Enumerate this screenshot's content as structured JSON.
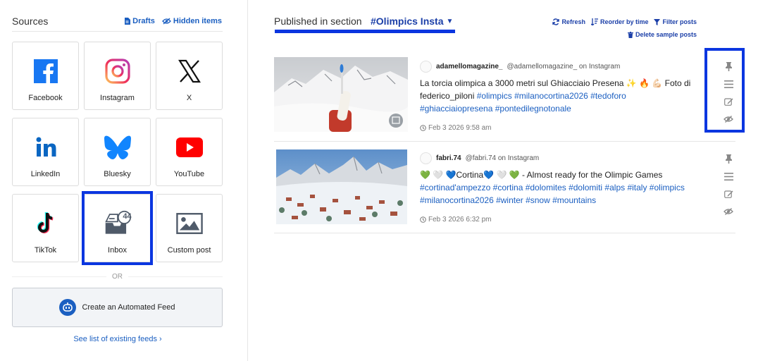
{
  "sources": {
    "title": "Sources",
    "drafts_label": "Drafts",
    "hidden_label": "Hidden items",
    "tiles": [
      {
        "label": "Facebook",
        "icon": "facebook-icon"
      },
      {
        "label": "Instagram",
        "icon": "instagram-icon"
      },
      {
        "label": "X",
        "icon": "x-icon"
      },
      {
        "label": "LinkedIn",
        "icon": "linkedin-icon"
      },
      {
        "label": "Bluesky",
        "icon": "bluesky-icon"
      },
      {
        "label": "YouTube",
        "icon": "youtube-icon"
      },
      {
        "label": "TikTok",
        "icon": "tiktok-icon"
      },
      {
        "label": "Inbox",
        "icon": "inbox-icon",
        "badge": "44"
      },
      {
        "label": "Custom post",
        "icon": "image-icon"
      }
    ],
    "or_label": "OR",
    "automated_feed_label": "Create an Automated Feed",
    "see_list_label": "See list of existing feeds ›"
  },
  "header": {
    "published_label": "Published in section",
    "section_name": "#Olimpics Insta",
    "refresh_label": "Refresh",
    "reorder_label": "Reorder by time",
    "filter_label": "Filter posts",
    "delete_sample_label": "Delete sample posts"
  },
  "colors": {
    "accent": "#1b5fc1",
    "highlight": "#0b36e0",
    "facebook": "#1877f2",
    "youtube": "#ff0000",
    "bluesky": "#1185fe"
  },
  "posts": [
    {
      "username": "adamellomagazine_",
      "handle": "@adamellomagazine_ on Instagram",
      "text": "La torcia olimpica a 3000 metri sul Ghiacciaio Presena ✨ 🔥 💪🏻 Foto di federico_piloni ",
      "tags": "#olimpics #milanocortina2026 #tedoforo #ghiacciaiopresena #pontedilegnotonale",
      "date": "Feb 3 2026 9:58 am"
    },
    {
      "username": "fabri.74",
      "handle": "@fabri.74 on Instagram",
      "text": "💚 🤍 💙Cortina💙 🤍 💚 - Almost ready for the Olimpic Games ",
      "tags": "#cortinad'ampezzo #cortina #dolomites #dolomiti #alps #italy #olimpics #milanocortina2026 #winter #snow #mountains",
      "date": "Feb 3 2026 6:32 pm"
    }
  ]
}
